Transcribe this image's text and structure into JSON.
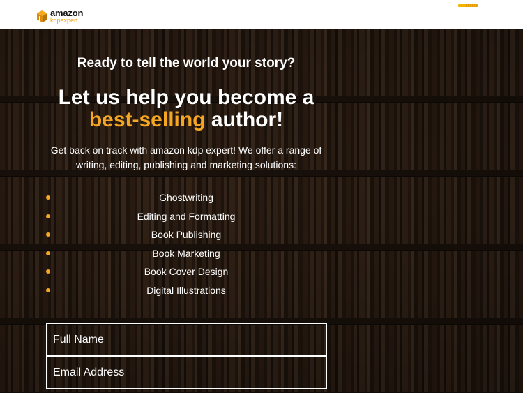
{
  "header": {
    "logo": {
      "main": "amazon",
      "sub": "kdpexpert"
    },
    "menu_icon": "hamburger-menu-icon"
  },
  "hero": {
    "kicker": "Ready to tell the world your story?",
    "headline_part1": "Let us help you become a",
    "headline_accent": "best-selling",
    "headline_part2": "author!",
    "intro": "Get back on track with amazon kdp expert! We offer a range of writing, editing, publishing and marketing solutions:",
    "services": [
      "Ghostwriting",
      "Editing and Formatting",
      "Book Publishing",
      "Book Marketing",
      "Book Cover Design",
      "Digital Illustrations"
    ]
  },
  "form": {
    "full_name_placeholder": "Full Name",
    "email_placeholder": "Email Address"
  },
  "colors": {
    "accent": "#f5a623",
    "header_bg": "#ffffff",
    "text": "#ffffff"
  }
}
